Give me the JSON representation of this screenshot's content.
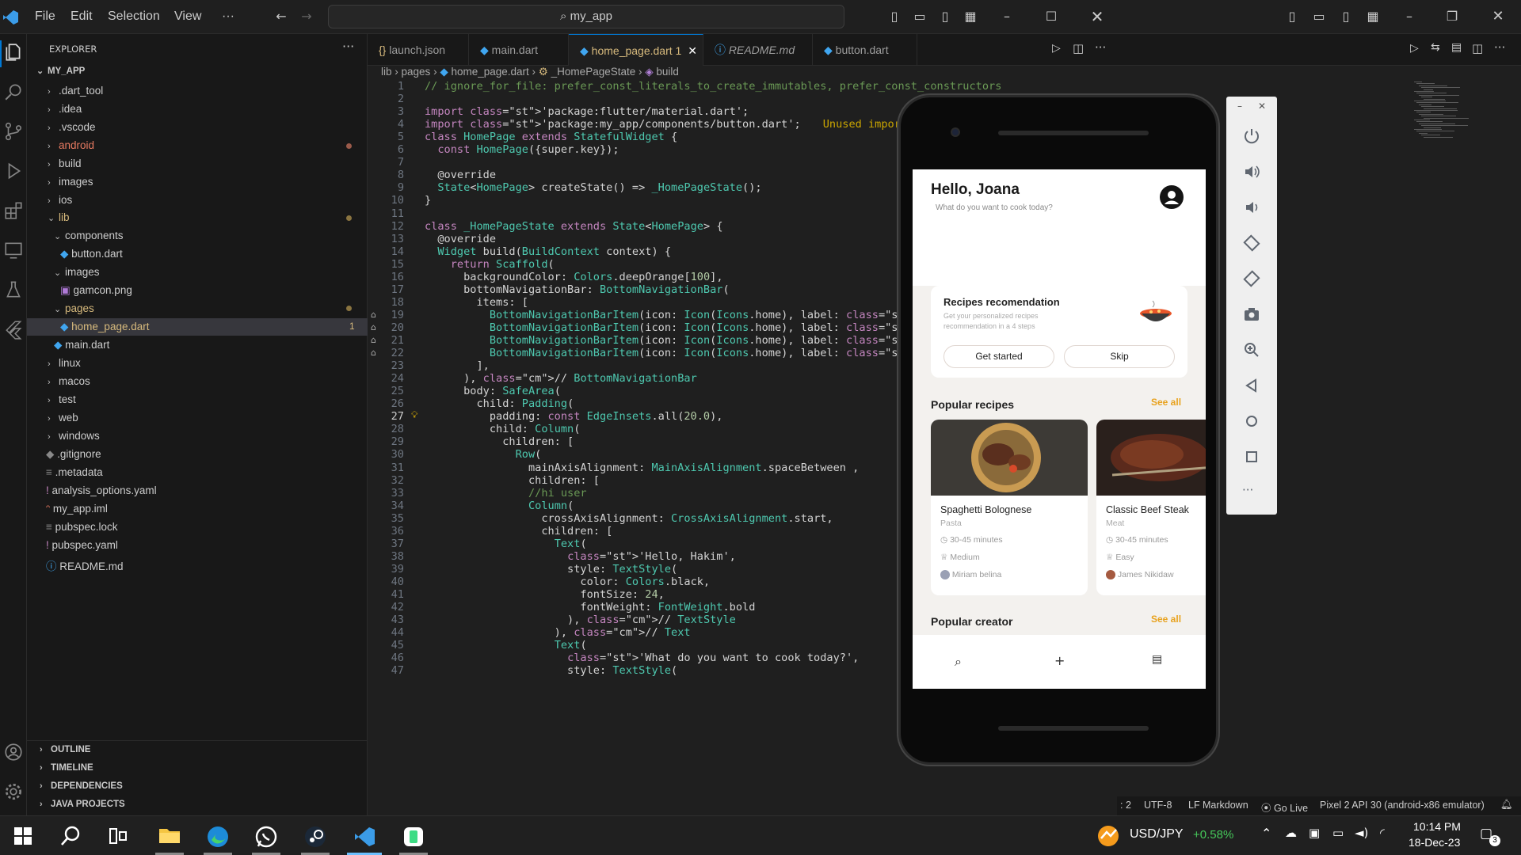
{
  "menu": {
    "file": "File",
    "edit": "Edit",
    "selection": "Selection",
    "view": "View",
    "more": "···"
  },
  "search": {
    "text": "my_app"
  },
  "explorer": {
    "title": "EXPLORER",
    "root": "MY_APP",
    "items": [
      ".dart_tool",
      ".idea",
      ".vscode",
      "android",
      "build",
      "images",
      "ios",
      "lib",
      "components",
      "button.dart",
      "images",
      "gamcon.png",
      "pages",
      "home_page.dart",
      "main.dart",
      "linux",
      "macos",
      "test",
      "web",
      "windows",
      ".gitignore",
      ".metadata",
      "analysis_options.yaml",
      "my_app.iml",
      "pubspec.lock",
      "pubspec.yaml",
      "README.md"
    ],
    "problem_count": "1",
    "sections": [
      "OUTLINE",
      "TIMELINE",
      "DEPENDENCIES",
      "JAVA PROJECTS"
    ]
  },
  "tabs": [
    {
      "label": "launch.json",
      "icon": "{}"
    },
    {
      "label": "main.dart"
    },
    {
      "label": "home_page.dart",
      "badge": "1"
    },
    {
      "label": "README.md",
      "icon": "ⓘ"
    },
    {
      "label": "button.dart"
    }
  ],
  "breadcrumb": {
    "a": "lib",
    "b": "pages",
    "c": "home_page.dart",
    "d": "_HomePageState",
    "e": "build"
  },
  "code": [
    "// ignore_for_file: prefer_const_literals_to_create_immutables, prefer_const_constructors",
    "",
    "import 'package:flutter/material.dart';",
    "import 'package:my_app/components/button.dart';",
    "class HomePage extends StatefulWidget {",
    "  const HomePage({super.key});",
    "",
    "  @override",
    "  State<HomePage> createState() => _HomePageState();",
    "}",
    "",
    "class _HomePageState extends State<HomePage> {",
    "  @override",
    "  Widget build(BuildContext context) {",
    "    return Scaffold(",
    "      backgroundColor: Colors.deepOrange[100],",
    "      bottomNavigationBar: BottomNavigationBar(",
    "        items: [",
    "          BottomNavigationBarItem(icon: Icon(Icons.home), label: ''),",
    "          BottomNavigationBarItem(icon: Icon(Icons.home), label: ''),",
    "          BottomNavigationBarItem(icon: Icon(Icons.home), label: ''),",
    "          BottomNavigationBarItem(icon: Icon(Icons.home), label: '')",
    "        ],",
    "      ), // BottomNavigationBar",
    "      body: SafeArea(",
    "        child: Padding(",
    "          padding: const EdgeInsets.all(20.0),",
    "          child: Column(",
    "            children: [",
    "              Row(",
    "                mainAxisAlignment: MainAxisAlignment.spaceBetween ,",
    "                children: [",
    "                //hi user",
    "                Column(",
    "                  crossAxisAlignment: CrossAxisAlignment.start,",
    "                  children: [",
    "                    Text(",
    "                      'Hello, Hakim',",
    "                      style: TextStyle(",
    "                        color: Colors.black,",
    "                        fontSize: 24,",
    "                        fontWeight: FontWeight.bold",
    "                      ), // TextStyle",
    "                    ), // Text",
    "                    Text(",
    "                      'What do you want to cook today?',",
    "                      style: TextStyle("
  ],
  "warning": "Unused import: 'package:",
  "app": {
    "greeting": "Hello, Joana",
    "subtitle": "What do you want to cook today?",
    "card_title": "Recipes recomendation",
    "card_desc": "Get your personalized recipes recommendation in a 4 steps",
    "btn_start": "Get started",
    "btn_skip": "Skip",
    "popular": "Popular recipes",
    "see_all": "See all",
    "recipes": [
      {
        "name": "Spaghetti Bolognese",
        "cat": "Pasta",
        "time": "30-45 minutes",
        "level": "Medium",
        "author": "Miriam belina"
      },
      {
        "name": "Classic Beef Steak",
        "cat": "Meat",
        "time": "30-45 minutes",
        "level": "Easy",
        "author": "James Nikidaw"
      }
    ],
    "creator": "Popular creator",
    "see_all2": "See all"
  },
  "status": {
    "a": ": 2",
    "enc": "UTF-8",
    "eol": "LF",
    "lang": "Markdown",
    "golive": "Go Live",
    "device": "Pixel 2 API 30 (android-x86 emulator)"
  },
  "taskbar": {
    "ticker": "USD/JPY",
    "change": "+0.58%",
    "time": "10:14 PM",
    "date": "18-Dec-23",
    "notif": "3"
  }
}
